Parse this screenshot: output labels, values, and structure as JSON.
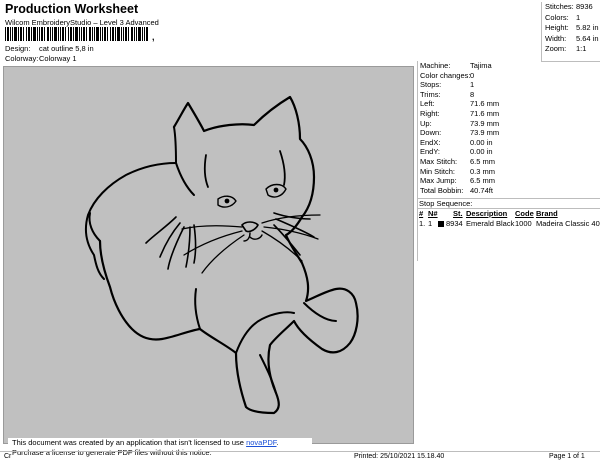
{
  "header": {
    "title": "Production Worksheet",
    "subtitle": "Wilcom EmbroideryStudio – Level 3 Advanced",
    "barcode_suffix": ","
  },
  "design_meta": [
    {
      "key": "Design:",
      "value": "cat outline 5,8 in"
    },
    {
      "key": "Colorway:",
      "value": "Colorway 1"
    }
  ],
  "stats": [
    {
      "key": "Stitches:",
      "value": "8936"
    },
    {
      "key": "Colors:",
      "value": "1"
    },
    {
      "key": "Height:",
      "value": "5.82 in"
    },
    {
      "key": "Width:",
      "value": "5.64 in"
    },
    {
      "key": "Zoom:",
      "value": "1:1"
    }
  ],
  "machine_info": [
    {
      "key": "Machine:",
      "value": "Tajima"
    },
    {
      "key": "Color changes:",
      "value": "0"
    },
    {
      "key": "Stops:",
      "value": "1"
    },
    {
      "key": "Trims:",
      "value": "8"
    },
    {
      "key": "Left:",
      "value": "71.6 mm"
    },
    {
      "key": "Right:",
      "value": "71.6 mm"
    },
    {
      "key": "Up:",
      "value": "73.9 mm"
    },
    {
      "key": "Down:",
      "value": "73.9 mm"
    },
    {
      "key": "EndX:",
      "value": "0.00 in"
    },
    {
      "key": "EndY:",
      "value": "0.00 in"
    },
    {
      "key": "Max Stitch:",
      "value": "6.5 mm"
    },
    {
      "key": "Min Stitch:",
      "value": "0.3 mm"
    },
    {
      "key": "Max Jump:",
      "value": "6.5 mm"
    },
    {
      "key": "Total Bobbin:",
      "value": "40.74ft"
    }
  ],
  "stop_sequence": {
    "label": "Stop Sequence:",
    "headers": {
      "num": "#",
      "n": "N#",
      "st": "St.",
      "description": "Description",
      "code": "Code",
      "brand": "Brand"
    },
    "rows": [
      {
        "num": "1.",
        "n": "1",
        "swatch_color": "#000000",
        "st": "8934",
        "description": "Emerald Black",
        "code": "1000",
        "brand": "Madeira Classic 40"
      }
    ]
  },
  "notice": {
    "line1": "This document was created by an application that isn't licensed to use",
    "link": "novaPDF",
    "line1_end": ".",
    "line2": "Purchase a license to generate PDF files without this notice."
  },
  "footer": {
    "left": "Cr",
    "printed": "Printed: 25/10/2021 15.18.40",
    "page": "Page 1 of 1"
  },
  "colors": {
    "canvas_bg": "#c0c0c0",
    "thread": "#000000",
    "link": "#1a4fd6"
  }
}
